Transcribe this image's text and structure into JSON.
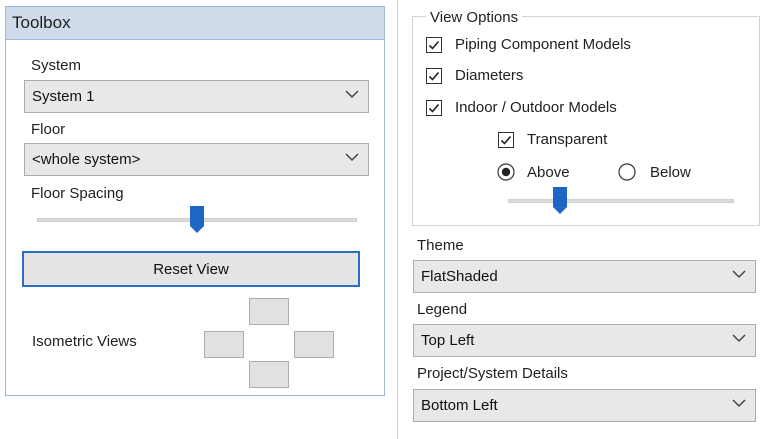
{
  "toolbox": {
    "title": "Toolbox",
    "system": {
      "label": "System",
      "value": "System 1"
    },
    "floor": {
      "label": "Floor",
      "value": "<whole system>"
    },
    "floor_spacing": {
      "label": "Floor Spacing",
      "level": 0.5
    },
    "reset_view_label": "Reset View",
    "isometric_views_label": "Isometric Views"
  },
  "view_options": {
    "legend": "View Options",
    "piping_component_models": {
      "label": "Piping Component Models",
      "checked": true
    },
    "diameters": {
      "label": "Diameters",
      "checked": true
    },
    "indoor_outdoor_models": {
      "label": "Indoor / Outdoor Models",
      "checked": true
    },
    "transparent": {
      "label": "Transparent",
      "checked": true
    },
    "above": {
      "label": "Above",
      "selected": true
    },
    "below": {
      "label": "Below",
      "selected": false
    },
    "transparency_level": 0.25
  },
  "theme": {
    "label": "Theme",
    "value": "FlatShaded"
  },
  "legend": {
    "label": "Legend",
    "value": "Top Left"
  },
  "project_system_details": {
    "label": "Project/System Details",
    "value": "Bottom Left"
  },
  "colors": {
    "accent": "#2b6fbf",
    "header": "#cfdbe9",
    "combo": "#e8e8e8"
  },
  "icons": [
    "chevron-down-icon",
    "checkmark-icon",
    "slider-thumb-icon"
  ]
}
